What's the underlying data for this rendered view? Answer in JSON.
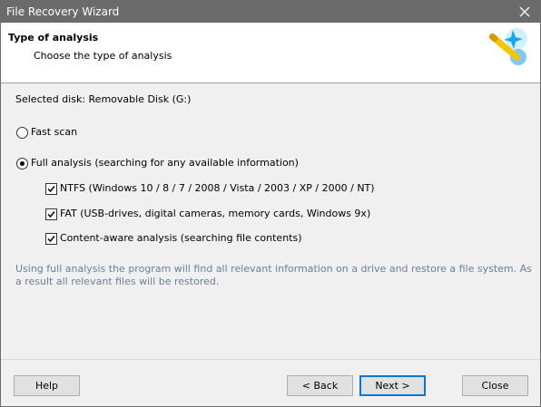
{
  "window": {
    "title": "File Recovery Wizard"
  },
  "header": {
    "title": "Type of analysis",
    "subtitle": "Choose the type of analysis",
    "icon": "magic-wand-icon"
  },
  "selected_disk": "Selected disk: Removable Disk (G:)",
  "options": {
    "fast_scan": {
      "label": "Fast scan",
      "checked": false
    },
    "full_analysis": {
      "label": "Full analysis (searching for any available information)",
      "checked": true
    }
  },
  "suboptions": [
    {
      "label": "NTFS (Windows 10 / 8 / 7 / 2008 / Vista / 2003 / XP / 2000 / NT)",
      "checked": true
    },
    {
      "label": "FAT (USB-drives, digital cameras, memory cards, Windows 9x)",
      "checked": true
    },
    {
      "label": "Content-aware analysis (searching file contents)",
      "checked": true
    }
  ],
  "note": "Using full analysis the program will find all relevant information on a drive and restore a file system. As a result all relevant files will be restored.",
  "buttons": {
    "help": "Help",
    "back": "< Back",
    "next": "Next >",
    "close": "Close"
  },
  "colors": {
    "titlebar": "#6b6b6b",
    "note_text": "#6b7f9a",
    "primary_border": "#0078d7"
  }
}
